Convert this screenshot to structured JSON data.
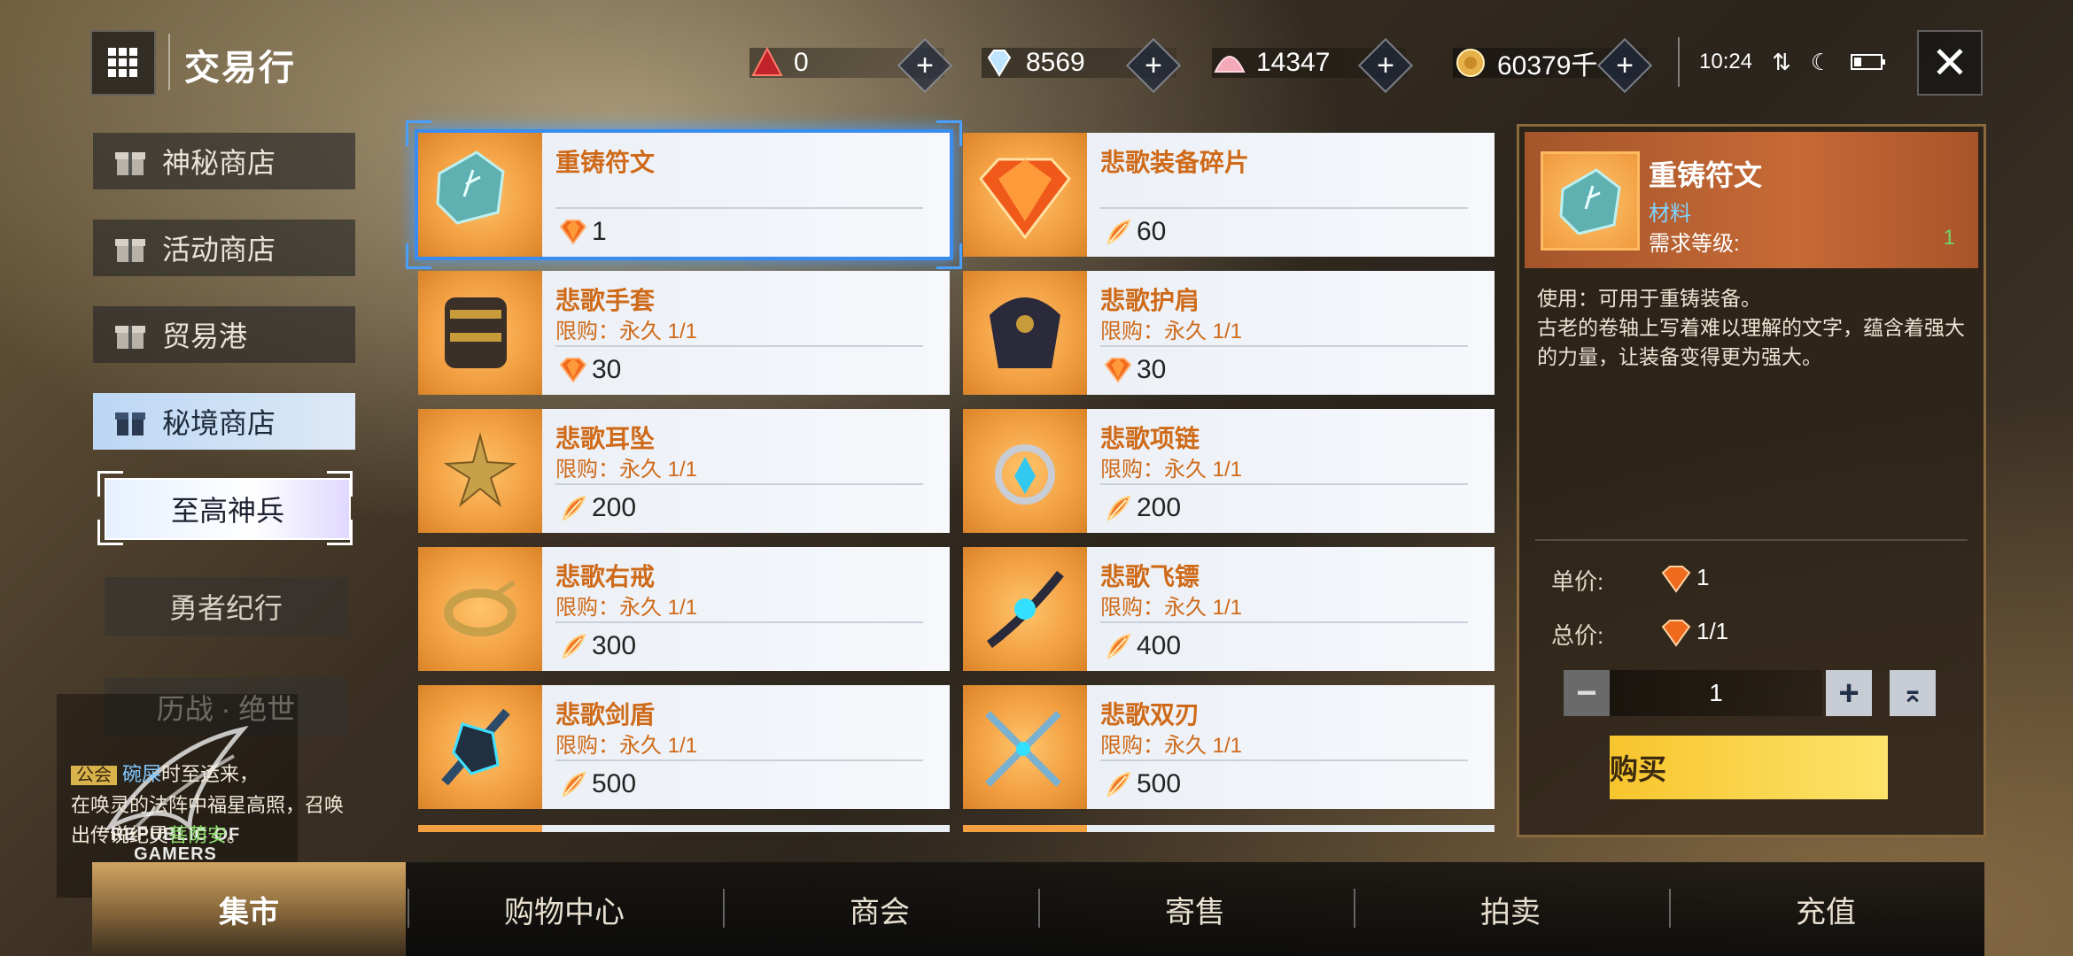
{
  "header": {
    "title": "交易行"
  },
  "resources": [
    {
      "icon": "red-crystal-icon",
      "value": "0"
    },
    {
      "icon": "diamond-icon",
      "value": "8569"
    },
    {
      "icon": "shell-icon",
      "value": "14347"
    },
    {
      "icon": "gold-coin-icon",
      "value": "60379千"
    }
  ],
  "status": {
    "time": "10:24"
  },
  "sidebar": {
    "items": [
      {
        "label": "神秘商店"
      },
      {
        "label": "活动商店"
      },
      {
        "label": "贸易港"
      },
      {
        "label": "秘境商店",
        "active": true
      }
    ],
    "sub_items": [
      {
        "label": "至高神兵",
        "active": true
      },
      {
        "label": "勇者纪行"
      },
      {
        "label": "历战 · 绝世"
      }
    ]
  },
  "items": [
    {
      "name": "重铸符文",
      "limit": "",
      "price": "1",
      "currency": "red-gem-icon",
      "selected": true
    },
    {
      "name": "悲歌装备碎片",
      "limit": "",
      "price": "60",
      "currency": "feather-icon"
    },
    {
      "name": "悲歌手套",
      "limit": "限购：永久 1/1",
      "price": "30",
      "currency": "red-gem-icon"
    },
    {
      "name": "悲歌护肩",
      "limit": "限购：永久 1/1",
      "price": "30",
      "currency": "red-gem-icon"
    },
    {
      "name": "悲歌耳坠",
      "limit": "限购：永久 1/1",
      "price": "200",
      "currency": "feather-icon"
    },
    {
      "name": "悲歌项链",
      "limit": "限购：永久 1/1",
      "price": "200",
      "currency": "feather-icon"
    },
    {
      "name": "悲歌右戒",
      "limit": "限购：永久 1/1",
      "price": "300",
      "currency": "feather-icon"
    },
    {
      "name": "悲歌飞镖",
      "limit": "限购：永久 1/1",
      "price": "400",
      "currency": "feather-icon"
    },
    {
      "name": "悲歌剑盾",
      "limit": "限购：永久 1/1",
      "price": "500",
      "currency": "feather-icon"
    },
    {
      "name": "悲歌双刃",
      "limit": "限购：永久 1/1",
      "price": "500",
      "currency": "feather-icon"
    }
  ],
  "detail": {
    "name": "重铸符文",
    "type": "材料",
    "req_label": "需求等级:",
    "req_value": "1",
    "description_use": "使用：可用于重铸装备。",
    "description_lore": "古老的卷轴上写着难以理解的文字，蕴含着强大的力量，让装备变得更为强大。",
    "unit_price_label": "单价:",
    "unit_price": "1",
    "total_price_label": "总价:",
    "total_price": "1/1",
    "quantity": "1",
    "buy_label": "购买"
  },
  "tabs": [
    {
      "label": "集市",
      "active": true
    },
    {
      "label": "购物中心"
    },
    {
      "label": "商会"
    },
    {
      "label": "寄售"
    },
    {
      "label": "拍卖"
    },
    {
      "label": "充值"
    }
  ],
  "announcement": {
    "tag": "公会",
    "line1_pre": "",
    "line1_hl": "碗屎",
    "line1_post": "时至运来，",
    "line2": "在唤灵的法阵中福星高照，召唤",
    "line3_pre": "出传说纪灵",
    "line3_hl": "菩荫安",
    "line3_post": "。"
  },
  "watermark": "REPUBLIC OF GAMERS"
}
